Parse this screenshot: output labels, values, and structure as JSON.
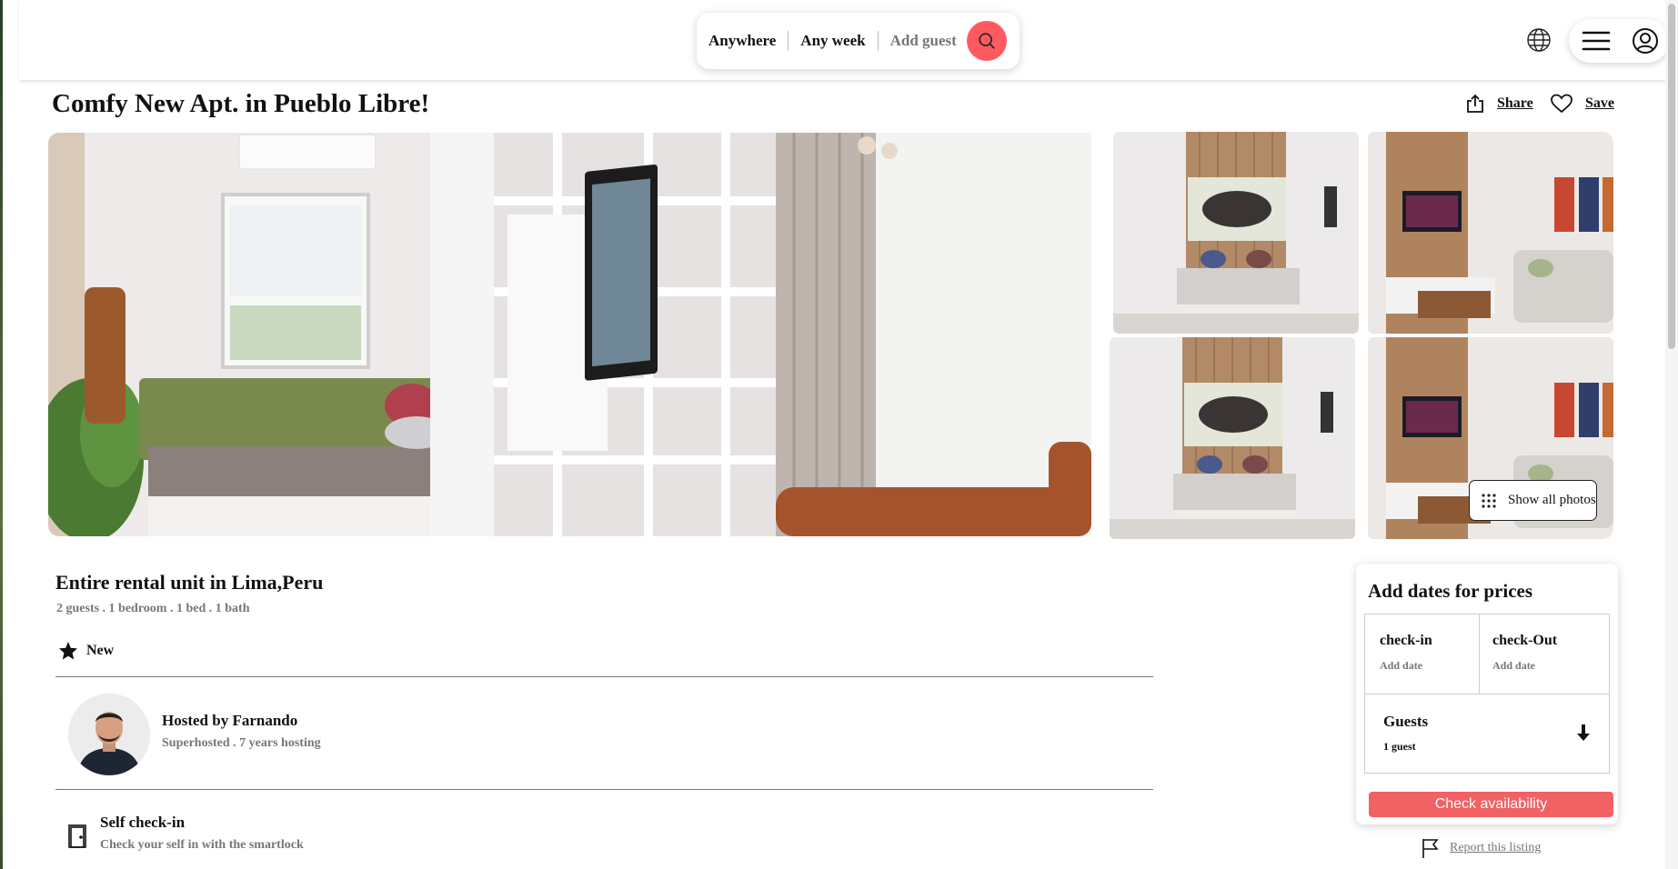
{
  "header": {
    "search": {
      "anywhere": "Anywhere",
      "any_week": "Any week",
      "add_guest": "Add guest"
    }
  },
  "listing": {
    "title": "Comfy New Apt. in Pueblo Libre!",
    "share_label": "Share",
    "save_label": "Save",
    "show_all_photos": "Show all photos",
    "heading": "Entire rental unit in Lima,Peru",
    "summary": "2 guests . 1 bedroom . 1 bed . 1 bath",
    "badge": "New",
    "host_name": "Hosted by Farnando",
    "host_sub": "Superhosted . 7 years hosting",
    "feature_title": "Self check-in",
    "feature_sub": "Check your self in with the smartlock"
  },
  "booking": {
    "title": "Add dates for prices",
    "checkin_label": "check-in",
    "checkin_value": "Add date",
    "checkout_label": "check-Out",
    "checkout_value": "Add date",
    "guests_label": "Guests",
    "guests_value": "1 guest",
    "button_label": "Check availability",
    "report_label": "Report this listing"
  },
  "colors": {
    "accent": "#ff5a5f",
    "button": "#f26163"
  },
  "icons": [
    "search-icon",
    "globe-icon",
    "hamburger-icon",
    "user-circle-icon",
    "share-icon",
    "heart-icon",
    "grid-dots-icon",
    "star-icon",
    "door-icon",
    "arrow-down-icon",
    "flag-icon"
  ]
}
